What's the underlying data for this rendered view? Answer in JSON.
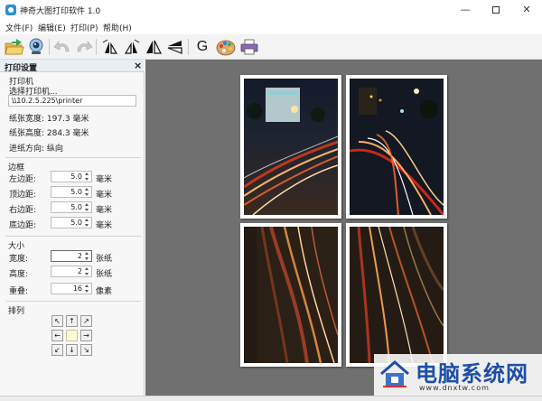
{
  "window": {
    "title": "神奇大图打印软件 1.0",
    "controls": {
      "minimize": "—",
      "close": "✕"
    }
  },
  "menu": [
    "文件(F)",
    "编辑(E)",
    "打印(P)",
    "帮助(H)"
  ],
  "toolbar": {
    "buttons": [
      "open-icon",
      "webcam-icon",
      "undo-icon",
      "redo-icon",
      "flip-left-icon",
      "flip-right-icon",
      "mirror-icon",
      "rotate-icon",
      "g-icon",
      "palette-icon",
      "print-icon"
    ],
    "g_label": "G"
  },
  "panel": {
    "title": "打印设置",
    "close": "×",
    "printer": {
      "heading": "打印机",
      "select_label": "选择打印机...",
      "path": "\\\\10.2.5.225\\printer",
      "path_button": "..."
    },
    "paper": {
      "width": "纸张宽度: 197.3 毫米",
      "height": "纸张高度: 284.3 毫米",
      "feed": "进纸方向: 纵向"
    },
    "margins": {
      "heading": "边框",
      "rows": [
        {
          "label": "左边距:",
          "value": "5.0",
          "unit": "毫米"
        },
        {
          "label": "顶边距:",
          "value": "5.0",
          "unit": "毫米"
        },
        {
          "label": "右边距:",
          "value": "5.0",
          "unit": "毫米"
        },
        {
          "label": "底边距:",
          "value": "5.0",
          "unit": "毫米"
        }
      ]
    },
    "size": {
      "heading": "大小",
      "rows": [
        {
          "label": "宽度:",
          "value": "2",
          "unit": "张纸"
        },
        {
          "label": "高度:",
          "value": "2",
          "unit": "张纸"
        },
        {
          "label": "重叠:",
          "value": "16",
          "unit": "像素"
        }
      ]
    },
    "arrange": {
      "heading": "排列",
      "arrows": [
        "↖",
        "↑",
        "↗",
        "←",
        "→",
        "↙",
        "↓",
        "↘"
      ]
    }
  },
  "preview": {
    "columns": 2,
    "rows": 2
  },
  "watermark": {
    "title": "电脑系统网",
    "url": "www.dnxtw.com"
  }
}
